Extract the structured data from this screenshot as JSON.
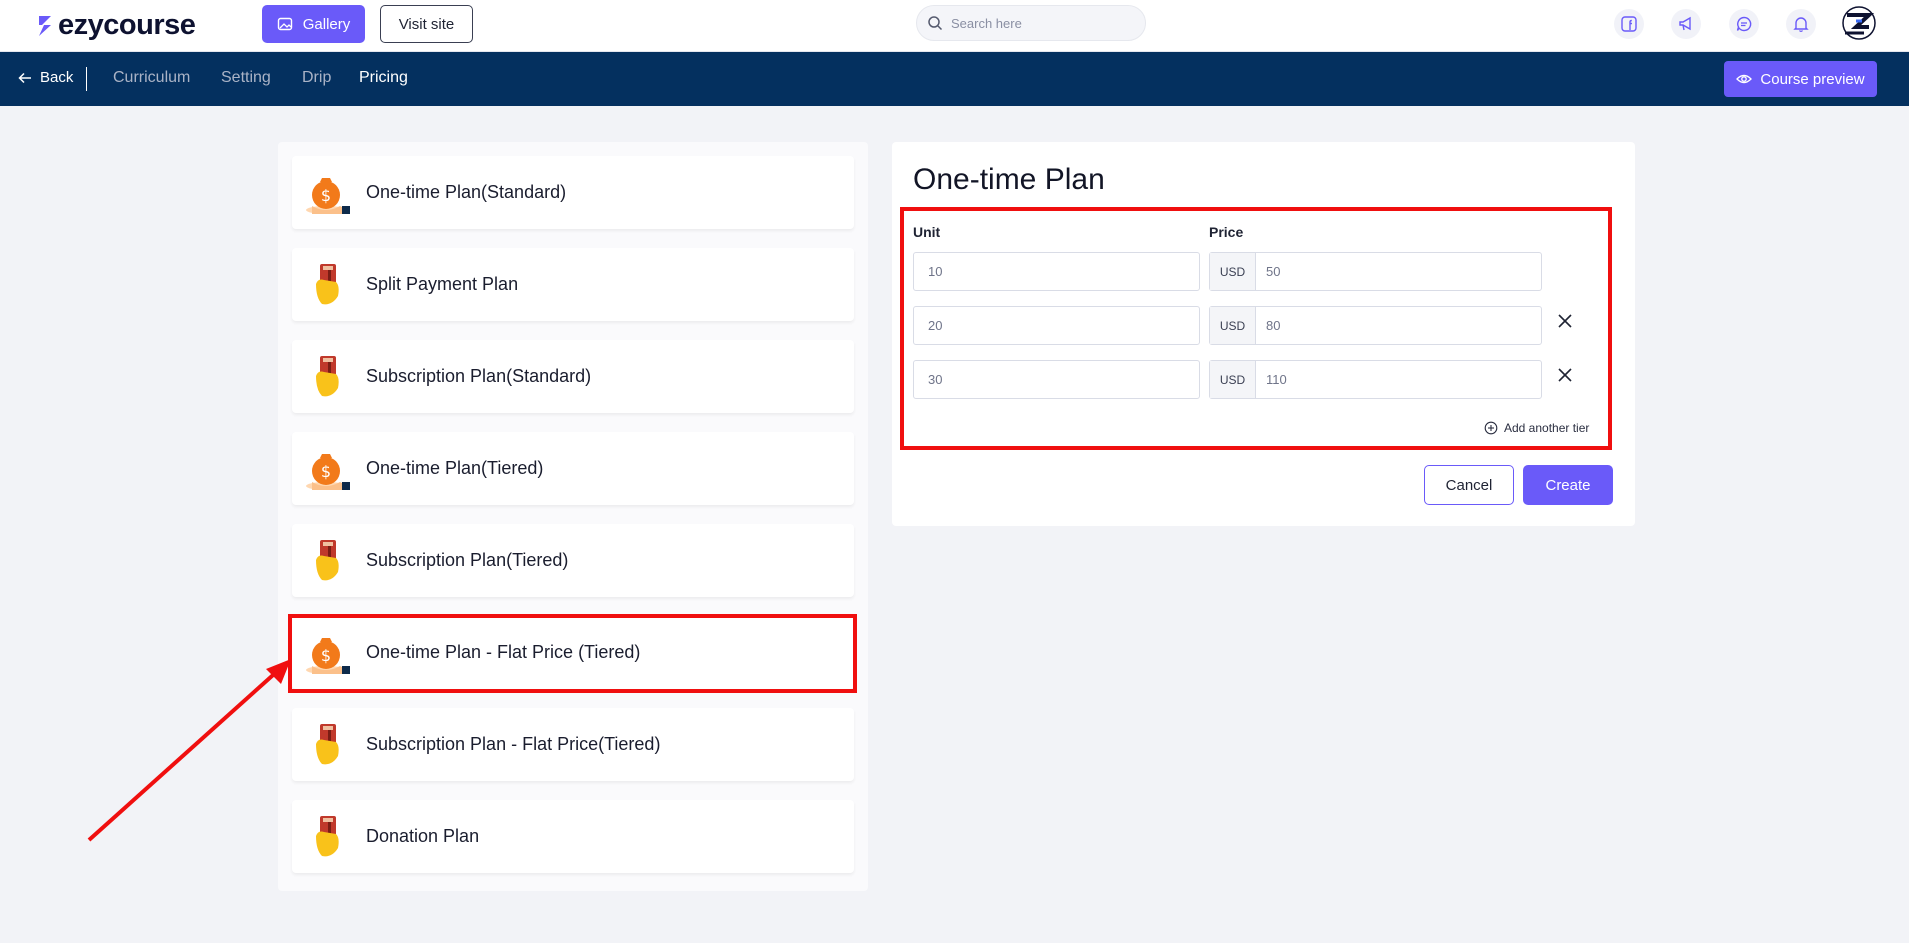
{
  "header": {
    "logo_text": "ezycourse",
    "gallery_label": "Gallery",
    "visit_site_label": "Visit site",
    "search_placeholder": "Search here",
    "icons": [
      "facebook-icon",
      "megaphone-icon",
      "chat-icon",
      "bell-icon"
    ]
  },
  "nav": {
    "back_label": "Back",
    "tabs": [
      {
        "label": "Curriculum",
        "active": false
      },
      {
        "label": "Setting",
        "active": false
      },
      {
        "label": "Drip",
        "active": false
      },
      {
        "label": "Pricing",
        "active": true
      }
    ],
    "preview_label": "Course preview"
  },
  "plans": [
    {
      "title": "One-time Plan(Standard)",
      "icon": "money-bag-icon"
    },
    {
      "title": "Split Payment Plan",
      "icon": "card-hand-icon"
    },
    {
      "title": "Subscription Plan(Standard)",
      "icon": "card-hand-icon"
    },
    {
      "title": "One-time Plan(Tiered)",
      "icon": "money-bag-icon"
    },
    {
      "title": "Subscription Plan(Tiered)",
      "icon": "card-hand-icon"
    },
    {
      "title": "One-time Plan - Flat Price (Tiered)",
      "icon": "money-bag-icon",
      "highlighted": true
    },
    {
      "title": "Subscription Plan - Flat Price(Tiered)",
      "icon": "card-hand-icon"
    },
    {
      "title": "Donation Plan",
      "icon": "card-hand-icon"
    }
  ],
  "form": {
    "title": "One-time Plan",
    "unit_label": "Unit",
    "price_label": "Price",
    "tiers": [
      {
        "unit": "10",
        "currency": "USD",
        "price": "50",
        "removable": false
      },
      {
        "unit": "20",
        "currency": "USD",
        "price": "80",
        "removable": true
      },
      {
        "unit": "30",
        "currency": "USD",
        "price": "110",
        "removable": true
      }
    ],
    "add_tier_label": "Add another tier",
    "cancel_label": "Cancel",
    "create_label": "Create"
  },
  "colors": {
    "accent": "#6a5af9",
    "nav_bg": "#04305f",
    "annotation": "#f00f0f"
  }
}
